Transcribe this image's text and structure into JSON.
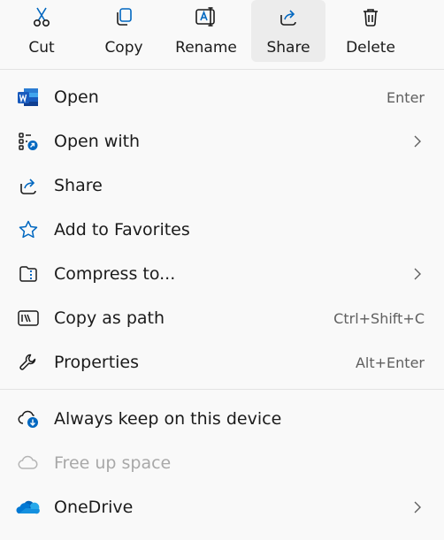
{
  "actions": [
    {
      "label": "Cut",
      "icon": "scissors-icon"
    },
    {
      "label": "Copy",
      "icon": "copy-icon"
    },
    {
      "label": "Rename",
      "icon": "rename-icon"
    },
    {
      "label": "Share",
      "icon": "share-icon"
    },
    {
      "label": "Delete",
      "icon": "trash-icon"
    }
  ],
  "items": [
    {
      "label": "Open",
      "shortcut": "Enter",
      "icon": "word-icon"
    },
    {
      "label": "Open with",
      "submenu": true,
      "icon": "open-with-icon"
    },
    {
      "label": "Share",
      "icon": "share-icon"
    },
    {
      "label": "Add to Favorites",
      "icon": "star-icon"
    },
    {
      "label": "Compress to...",
      "submenu": true,
      "icon": "zip-icon"
    },
    {
      "label": "Copy as path",
      "shortcut": "Ctrl+Shift+C",
      "icon": "path-icon"
    },
    {
      "label": "Properties",
      "shortcut": "Alt+Enter",
      "icon": "wrench-icon"
    }
  ],
  "cloud_items": [
    {
      "label": "Always keep on this device",
      "icon": "cloud-download-icon"
    },
    {
      "label": "Free up space",
      "disabled": true,
      "icon": "cloud-icon"
    },
    {
      "label": "OneDrive",
      "submenu": true,
      "icon": "onedrive-icon"
    }
  ],
  "colors": {
    "accent": "#0067c0",
    "word_blue": "#185abd",
    "onedrive_blue": "#0364b8",
    "disabled_text": "#a8a8a8"
  }
}
